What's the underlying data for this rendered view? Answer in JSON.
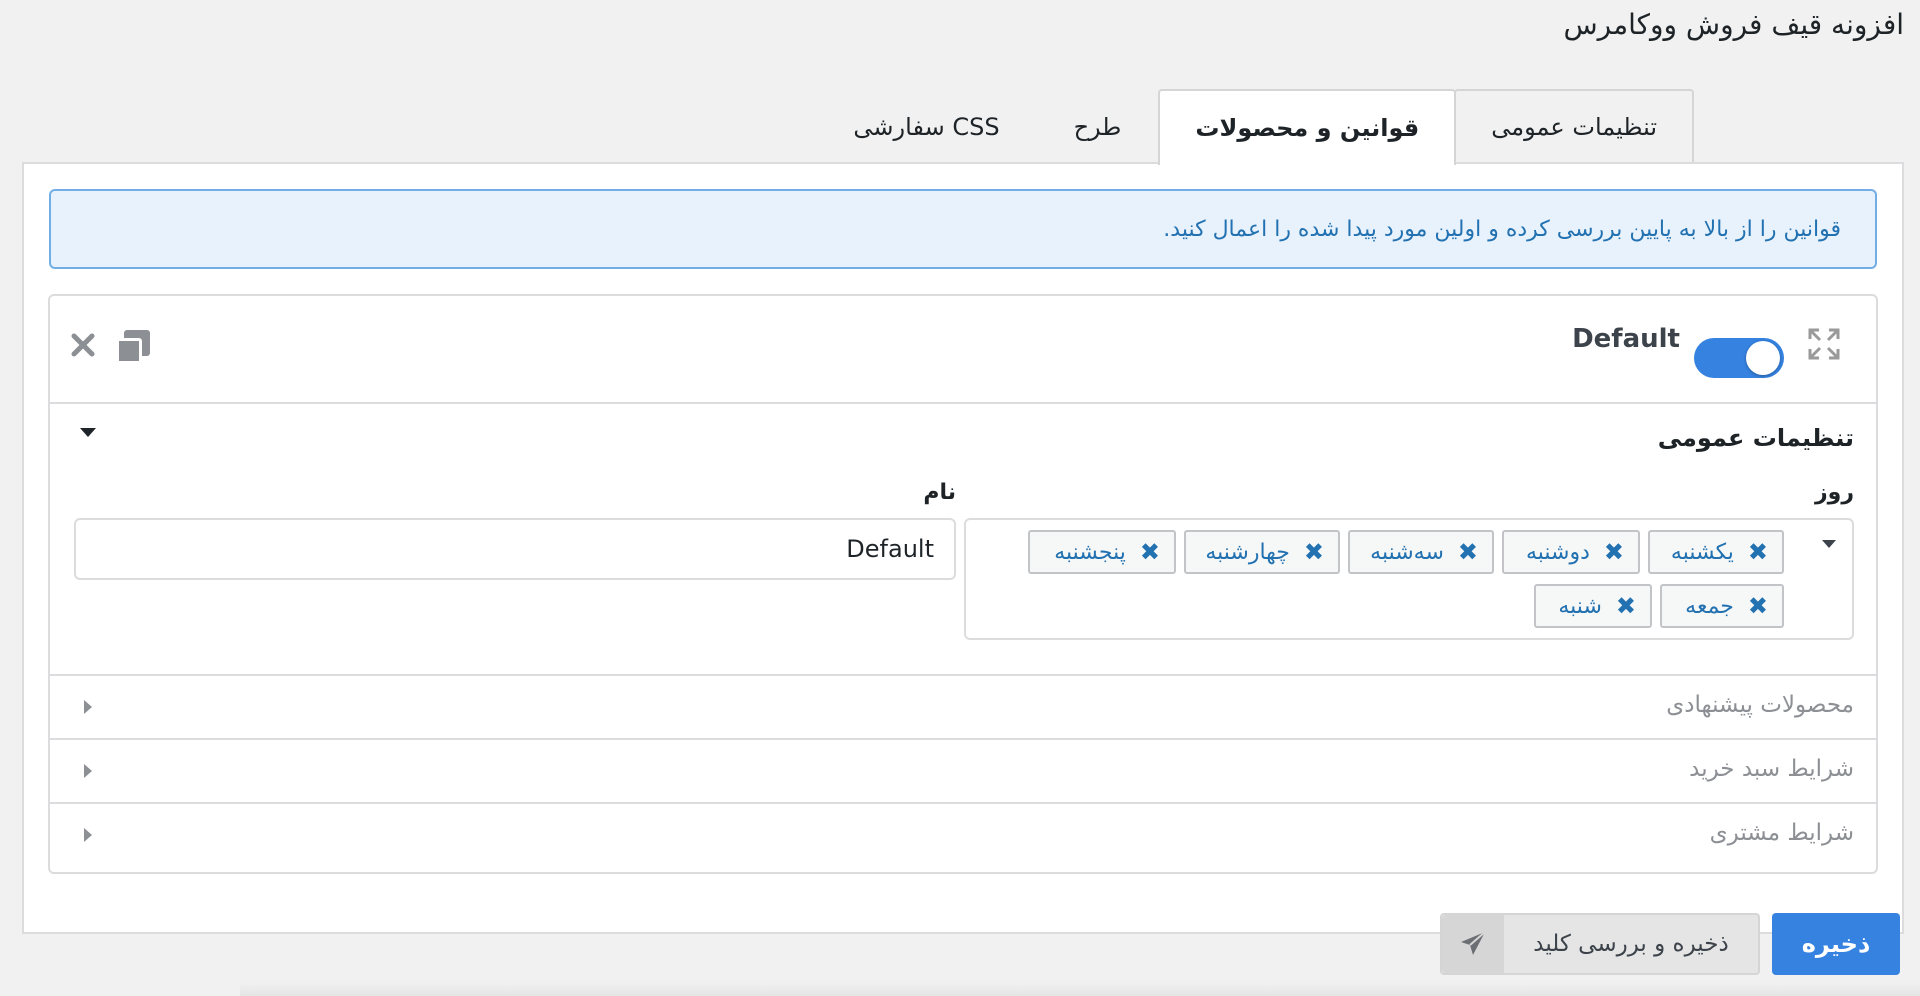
{
  "page": {
    "title": "افزونه قیف فروش ووکامرس"
  },
  "tabs": [
    {
      "label": "تنظیمات عمومی",
      "active": false
    },
    {
      "label": "قوانین و محصولات",
      "active": true
    },
    {
      "label": "طرح",
      "active": false
    },
    {
      "label": "CSS سفارشی",
      "active": false
    }
  ],
  "notice": {
    "text": "قوانین را از بالا به پایین بررسی کرده و اولین مورد پیدا شده را اعمال کنید."
  },
  "rule": {
    "name": "Default",
    "enabled": true,
    "icons": {
      "expand": "expand-icon",
      "copy": "copy-icon",
      "delete": "close-icon"
    },
    "general": {
      "title": "تنظیمات عمومی",
      "day_label": "روز",
      "name_label": "نام",
      "name_value": "Default",
      "days": [
        "یکشنبه",
        "دوشنبه",
        "سه‌شنبه",
        "چهارشنبه",
        "پنجشنبه",
        "جمعه",
        "شنبه"
      ],
      "remove_glyph": "✖"
    },
    "sections": [
      {
        "label": "محصولات پیشنهادی"
      },
      {
        "label": "شرایط سبد خرید"
      },
      {
        "label": "شرایط مشتری"
      }
    ]
  },
  "buttons": {
    "save": "ذخیره",
    "save_and_check": "ذخیره و بررسی کلید"
  },
  "colors": {
    "accent": "#3582e0",
    "notice_bg": "#e8f2fd",
    "notice_text": "#2271b1"
  }
}
